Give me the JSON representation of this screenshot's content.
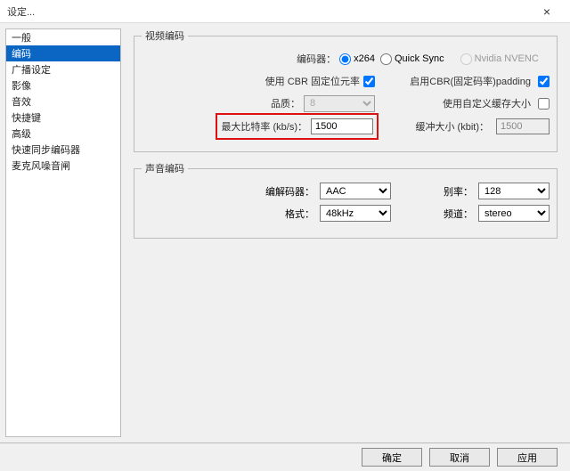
{
  "window": {
    "title": "设定..."
  },
  "sidebar": {
    "items": [
      "一般",
      "编码",
      "广播设定",
      "影像",
      "音效",
      "快捷键",
      "高级",
      "快速同步编码器",
      "麦克风噪音闸"
    ],
    "selected_index": 1
  },
  "video": {
    "legend": "视频编码",
    "encoder_label": "编码器：",
    "options": {
      "x264": "x264",
      "quicksync": "Quick Sync",
      "nvenc": "Nvidia NVENC"
    },
    "selected_encoder": "x264",
    "cbr_label": "使用 CBR 固定位元率",
    "cbr_checked": true,
    "cbr_padding_label": "启用CBR(固定码率)padding",
    "cbr_padding_checked": true,
    "quality_label": "品质：",
    "quality_value": "8",
    "custom_buffer_label": "使用自定义缓存大小",
    "custom_buffer_checked": false,
    "max_bitrate_label": "最大比特率 (kb/s)：",
    "max_bitrate_value": "1500",
    "buffer_size_label": "缓冲大小 (kbit)：",
    "buffer_size_value": "1500"
  },
  "audio": {
    "legend": "声音编码",
    "codec_label": "编解码器：",
    "codec_value": "AAC",
    "bitrate_label": "别率：",
    "bitrate_value": "128",
    "format_label": "格式：",
    "format_value": "48kHz",
    "channel_label": "频道：",
    "channel_value": "stereo"
  },
  "footer": {
    "ok": "确定",
    "cancel": "取消",
    "apply": "应用"
  }
}
